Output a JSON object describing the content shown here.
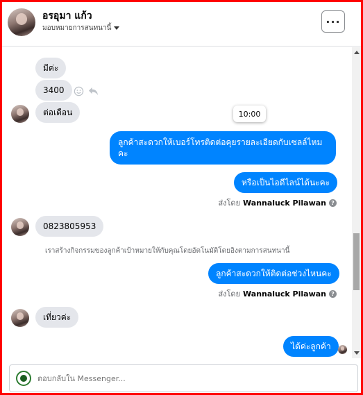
{
  "header": {
    "title": "อรอุมา แก้ว",
    "subtitle": "มอบหมายการสนทนานี้",
    "more_label": "···"
  },
  "messages": {
    "m1": "มีค่ะ",
    "m2": "3400",
    "m3": "ต่อเดือน",
    "m4_line1": "ลูกค้าสะดวกให้เบอร์โทรติดต่อคุยรายละเอียดกับเซลล์ไหม",
    "m4_line2": "คะ",
    "m5": "หรือเป็นไอดีไลน์ได้นะคะ",
    "m6": "0823805953",
    "m7": "ลูกค้าสะดวกให้ติดต่อช่วงไหนคะ",
    "m8": "เที่ยวค่ะ",
    "m9": "ได้ค่ะลูกค้า"
  },
  "tooltip_time": "10:00",
  "sent_by": {
    "prefix": "ส่งโดย",
    "name": "Wannaluck Pilawan",
    "help": "?"
  },
  "notice": "เราสร้างกิจกรรมของลูกค้าเป้าหมายให้กับคุณโดยอัตโนมัติโดยอิงตามการสนทนานี้",
  "composer": {
    "placeholder": "ตอบกลับใน Messenger..."
  },
  "colors": {
    "outgoing_bubble": "#0084ff",
    "incoming_bubble": "#e4e6eb",
    "frame_border": "#ff0000"
  }
}
